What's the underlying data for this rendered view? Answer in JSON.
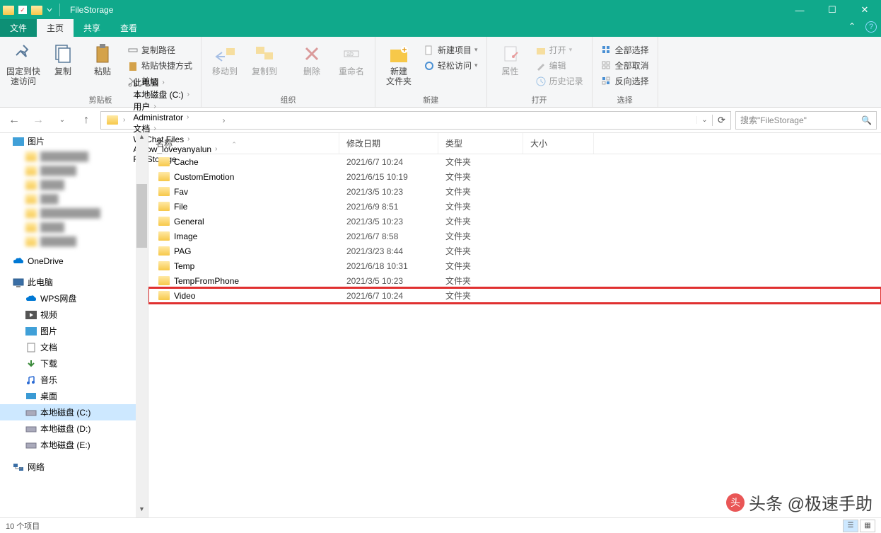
{
  "title": "FileStorage",
  "tabs": {
    "file": "文件",
    "home": "主页",
    "share": "共享",
    "view": "查看"
  },
  "ribbon": {
    "pin": "固定到快\n速访问",
    "copy": "复制",
    "paste": "粘贴",
    "copypath": "复制路径",
    "pasteshort": "粘贴快捷方式",
    "cut": "剪切",
    "g_clip": "剪贴板",
    "moveto": "移动到",
    "copyto": "复制到",
    "delete": "删除",
    "rename": "重命名",
    "g_org": "组织",
    "newfolder": "新建\n文件夹",
    "newitem": "新建项目",
    "easyaccess": "轻松访问",
    "g_new": "新建",
    "props": "属性",
    "open2": "打开",
    "edit2": "编辑",
    "history": "历史记录",
    "g_open": "打开",
    "selall": "全部选择",
    "selnone": "全部取消",
    "selinv": "反向选择",
    "g_sel": "选择"
  },
  "breadcrumbs": [
    "此电脑",
    "本地磁盘 (C:)",
    "用户",
    "Administrator",
    "文档",
    "WeChat Files",
    "Aarow_loveyanyalun",
    "FileStorage"
  ],
  "search_placeholder": "搜索\"FileStorage\"",
  "columns": {
    "name": "名称",
    "date": "修改日期",
    "type": "类型",
    "size": "大小"
  },
  "rows": [
    {
      "name": "Cache",
      "date": "2021/6/7 10:24",
      "type": "文件夹"
    },
    {
      "name": "CustomEmotion",
      "date": "2021/6/15 10:19",
      "type": "文件夹"
    },
    {
      "name": "Fav",
      "date": "2021/3/5 10:23",
      "type": "文件夹"
    },
    {
      "name": "File",
      "date": "2021/6/9 8:51",
      "type": "文件夹"
    },
    {
      "name": "General",
      "date": "2021/3/5 10:23",
      "type": "文件夹"
    },
    {
      "name": "Image",
      "date": "2021/6/7 8:58",
      "type": "文件夹"
    },
    {
      "name": "PAG",
      "date": "2021/3/23 8:44",
      "type": "文件夹"
    },
    {
      "name": "Temp",
      "date": "2021/6/18 10:31",
      "type": "文件夹"
    },
    {
      "name": "TempFromPhone",
      "date": "2021/3/5 10:23",
      "type": "文件夹"
    },
    {
      "name": "Video",
      "date": "2021/6/7 10:24",
      "type": "文件夹",
      "highlight": true
    }
  ],
  "tree": {
    "pictures": "图片",
    "onedrive": "OneDrive",
    "thispc": "此电脑",
    "wps": "WPS网盘",
    "videos": "视频",
    "pics2": "图片",
    "docs": "文档",
    "downloads": "下载",
    "music": "音乐",
    "desktop": "桌面",
    "diskc": "本地磁盘 (C:)",
    "diskd": "本地磁盘 (D:)",
    "diske": "本地磁盘 (E:)",
    "network": "网络"
  },
  "status": "10 个项目",
  "watermark": "头条 @极速手助"
}
